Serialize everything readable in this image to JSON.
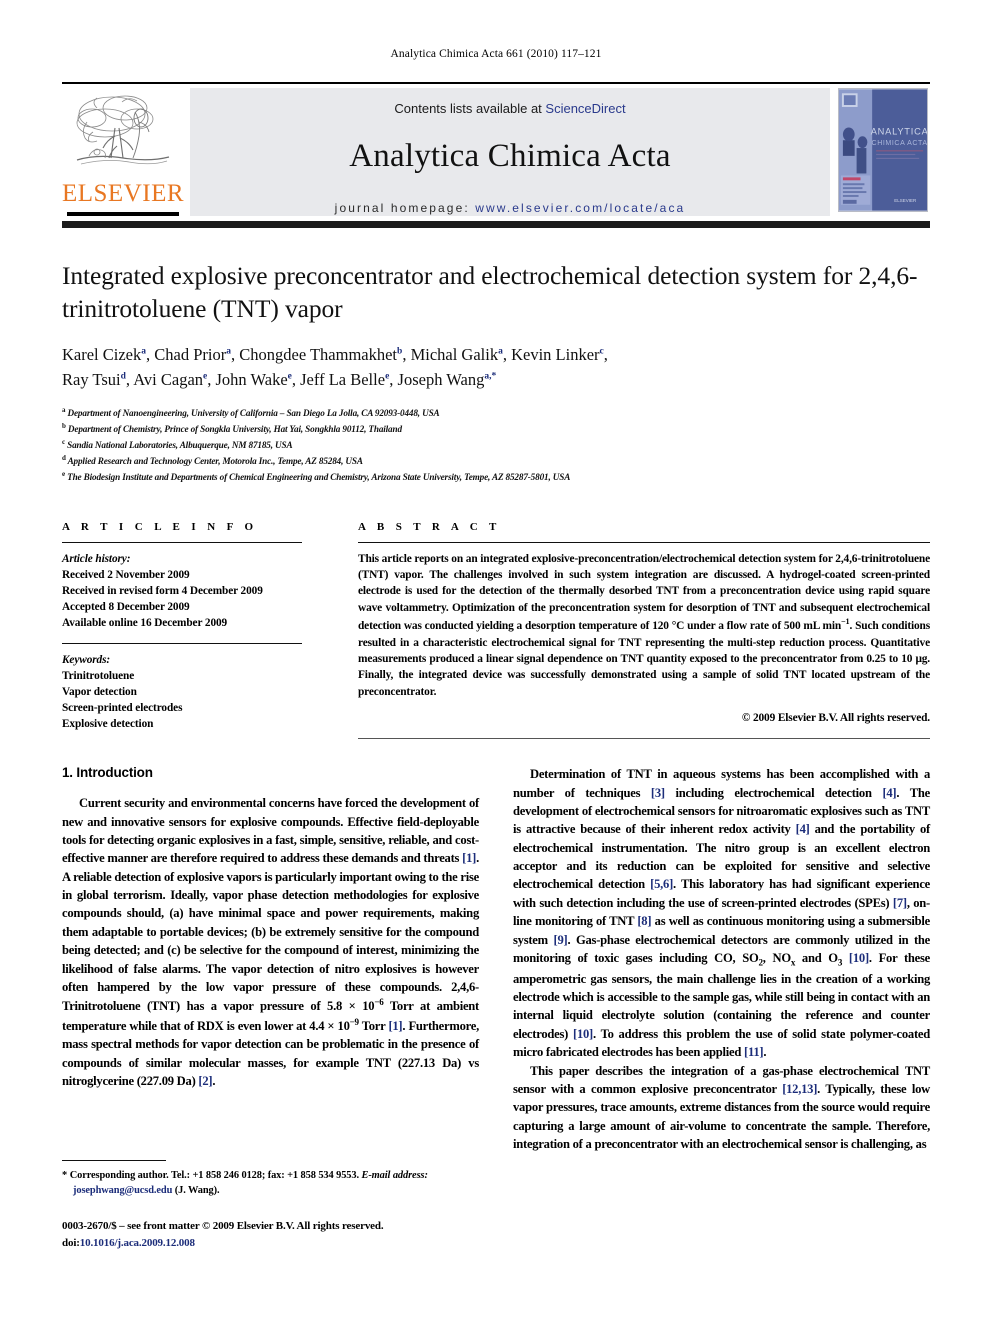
{
  "running_head": "Analytica Chimica Acta 661 (2010) 117–121",
  "masthead": {
    "contents_prefix": "Contents lists available at ",
    "sciencedirect": "ScienceDirect",
    "journal_title": "Analytica Chimica Acta",
    "homepage_prefix": "journal homepage:",
    "homepage_url": "www.elsevier.com/locate/aca",
    "publisher_wordmark": "ELSEVIER",
    "publisher_color": "#E87722",
    "link_color": "#2a3a8c",
    "cover_title_line1": "ANALYTICA",
    "cover_title_line2": "CHIMICA ACTA"
  },
  "article": {
    "title": "Integrated explosive preconcentrator and electrochemical detection system for 2,4,6-trinitrotoluene (TNT) vapor",
    "authors": [
      {
        "name": "Karel Cizek",
        "marks": "a",
        "sep": ", "
      },
      {
        "name": "Chad Prior",
        "marks": "a",
        "sep": ", "
      },
      {
        "name": "Chongdee Thammakhet",
        "marks": "b",
        "sep": ", "
      },
      {
        "name": "Michal Galik",
        "marks": "a",
        "sep": ", "
      },
      {
        "name": "Kevin Linker",
        "marks": "c",
        "sep": ", "
      },
      {
        "name": "Ray Tsui",
        "marks": "d",
        "sep": ", "
      },
      {
        "name": "Avi Cagan",
        "marks": "e",
        "sep": ", "
      },
      {
        "name": "John Wake",
        "marks": "e",
        "sep": ", "
      },
      {
        "name": "Jeff La Belle",
        "marks": "e",
        "sep": ", "
      },
      {
        "name": "Joseph Wang",
        "marks": "a,*",
        "sep": ""
      }
    ],
    "affiliations": [
      {
        "mark": "a",
        "text": "Department of Nanoengineering, University of California – San Diego La Jolla, CA 92093-0448, USA"
      },
      {
        "mark": "b",
        "text": "Department of Chemistry, Prince of Songkla University, Hat Yai, Songkhla 90112, Thailand"
      },
      {
        "mark": "c",
        "text": "Sandia National Laboratories, Albuquerque, NM 87185, USA"
      },
      {
        "mark": "d",
        "text": "Applied Research and Technology Center, Motorola Inc., Tempe, AZ 85284, USA"
      },
      {
        "mark": "e",
        "text": "The Biodesign Institute and Departments of Chemical Engineering and Chemistry, Arizona State University, Tempe, AZ 85287-5801, USA"
      }
    ]
  },
  "article_info": {
    "heading": "A R T I C L E    I N F O",
    "history_label": "Article history:",
    "history": [
      "Received 2 November 2009",
      "Received in revised form 4 December 2009",
      "Accepted 8 December 2009",
      "Available online 16 December 2009"
    ],
    "keywords_label": "Keywords:",
    "keywords": [
      "Trinitrotoluene",
      "Vapor detection",
      "Screen-printed electrodes",
      "Explosive detection"
    ]
  },
  "abstract": {
    "heading": "A B S T R A C T",
    "text_part1": "This article reports on an integrated explosive-preconcentration/electrochemical detection system for 2,4,6-trinitrotoluene (TNT) vapor. The challenges involved in such system integration are discussed. A hydrogel-coated screen-printed electrode is used for the detection of the thermally desorbed TNT from a preconcentration device using rapid square wave voltammetry. Optimization of the preconcentration system for desorption of TNT and subsequent electrochemical detection was conducted yielding a desorption temperature of 120 °C under a flow rate of 500 mL min",
    "flowrate_exponent": "−1",
    "text_part2": ". Such conditions resulted in a characteristic electrochemical signal for TNT representing the multi-step reduction process. Quantitative measurements produced a linear signal dependence on TNT quantity exposed to the preconcentrator from 0.25 to 10 μg. Finally, the integrated device was successfully demonstrated using a sample of solid TNT located upstream of the preconcentrator.",
    "copyright": "© 2009 Elsevier B.V. All rights reserved."
  },
  "introduction": {
    "section_number": "1.",
    "section_name": "Introduction",
    "left_p1_a": "Current security and environmental concerns have forced the development of new and innovative sensors for explosive compounds. Effective field-deployable tools for detecting organic explosives in a fast, simple, sensitive, reliable, and cost-effective manner are therefore required to address these demands and threats ",
    "left_p1_ref1": "[1]",
    "left_p1_b": ". A reliable detection of explosive vapors is particularly important owing to the rise in global terrorism. Ideally, vapor phase detection methodologies for explosive compounds should, (a) have minimal space and power requirements, making them adaptable to portable devices; (b) be extremely sensitive for the compound being detected; and (c) be selective for the compound of interest, minimizing the likelihood of false alarms. The vapor detection of nitro explosives is however often hampered by the low vapor pressure of these compounds. 2,4,6-Trinitrotoluene (TNT) has a vapor pressure of 5.8 × 10",
    "left_p1_exp1": "−6",
    "left_p1_c": " Torr at ambient temperature while that of RDX is even lower at 4.4 × 10",
    "left_p1_exp2": "−9",
    "left_p1_d": " Torr ",
    "left_p1_ref2": "[1]",
    "left_p1_e": ". Furthermore, mass spectral methods for vapor detection can be problematic in the presence of compounds of similar molecular masses, for example TNT (227.13 Da) vs nitroglycerine (227.09 Da) ",
    "left_p1_ref3": "[2]",
    "left_p1_f": ".",
    "right_p1_a": "Determination of TNT in aqueous systems has been accomplished with a number of techniques ",
    "right_p1_ref3": "[3]",
    "right_p1_b": " including electrochemical detection ",
    "right_p1_ref4a": "[4]",
    "right_p1_c": ". The development of electrochemical sensors for nitroaromatic explosives such as TNT is attractive because of their inherent redox activity ",
    "right_p1_ref4b": "[4]",
    "right_p1_d": " and the portability of electrochemical instrumentation. The nitro group is an excellent electron acceptor and its reduction can be exploited for sensitive and selective electrochemical detection ",
    "right_p1_ref56": "[5,6]",
    "right_p1_e": ". This laboratory has had significant experience with such detection including the use of screen-printed electrodes (SPEs) ",
    "right_p1_ref7": "[7]",
    "right_p1_f": ", on-line monitoring of TNT ",
    "right_p1_ref8": "[8]",
    "right_p1_g": " as well as continuous monitoring using a submersible system ",
    "right_p1_ref9": "[9]",
    "right_p1_h": ". Gas-phase electrochemical detectors are commonly utilized in the monitoring of toxic gases including CO, SO",
    "so2_sub": "2",
    "right_p1_i": ", NO",
    "nox_sub": "x",
    "right_p1_j": " and O",
    "o3_sub": "3",
    "right_p1_k": " ",
    "right_p1_ref10a": "[10]",
    "right_p1_l": ". For these amperometric gas sensors, the main challenge lies in the creation of a working electrode which is accessible to the sample gas, while still being in contact with an internal liquid electrolyte solution (containing the reference and counter electrodes) ",
    "right_p1_ref10b": "[10]",
    "right_p1_m": ". To address this problem the use of solid state polymer-coated micro fabricated electrodes has been applied ",
    "right_p1_ref11": "[11]",
    "right_p1_n": ".",
    "right_p2_a": "This paper describes the integration of a gas-phase electrochemical TNT sensor with a common explosive preconcentrator ",
    "right_p2_ref1213": "[12,13]",
    "right_p2_b": ". Typically, these low vapor pressures, trace amounts, extreme distances from the source would require capturing a large amount of air-volume to concentrate the sample. Therefore, integration of a preconcentrator with an electrochemical sensor is challenging, as"
  },
  "footnote": {
    "star": "*",
    "corresponding": "Corresponding author. Tel.: +1 858 246 0128; fax: +1 858 534 9553.",
    "email_label": "E-mail address:",
    "email": "josephwang@ucsd.edu",
    "email_owner": "(J. Wang)."
  },
  "footer": {
    "issn_line": "0003-2670/$ – see front matter © 2009 Elsevier B.V. All rights reserved.",
    "doi_label": "doi:",
    "doi_value": "10.1016/j.aca.2009.12.008"
  }
}
